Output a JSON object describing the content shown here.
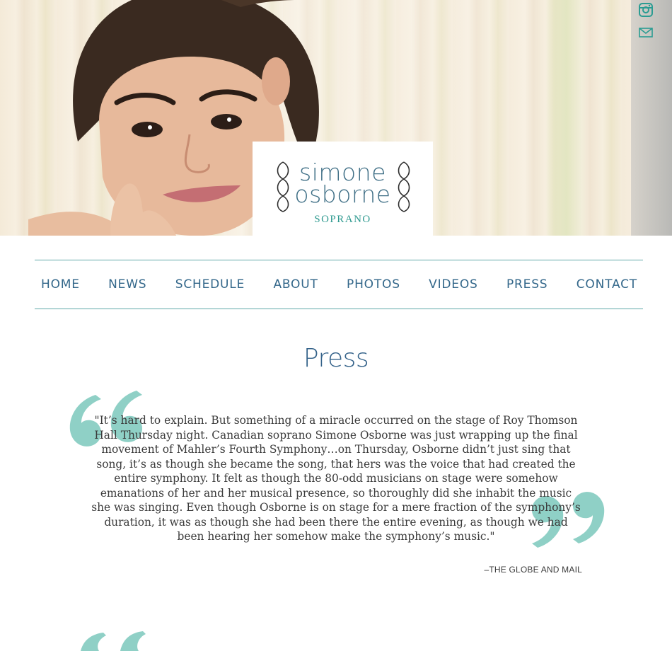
{
  "logo": {
    "name_line1": "simone",
    "name_line2": "osborne",
    "subtitle": "SOPRANO"
  },
  "social": {
    "items": [
      "instagram-icon",
      "email-icon"
    ]
  },
  "nav": {
    "items": [
      "HOME",
      "NEWS",
      "SCHEDULE",
      "ABOUT",
      "PHOTOS",
      "VIDEOS",
      "PRESS",
      "CONTACT"
    ]
  },
  "page": {
    "title": "Press",
    "quote": "\"It’s hard to explain. But something of a miracle occurred on the stage of Roy Thomson Hall Thursday night. Canadian soprano Simone Osborne was just wrapping up the final movement of Mahler’s Fourth Symphony…on Thursday, Osborne didn’t just sing that song, it’s as though she became the song, that hers was the voice that had created the entire symphony. It felt as though the 80-odd musicians on stage were somehow emanations of her and her musical presence, so thoroughly did she inhabit the music she was singing. Even though Osborne is on stage for a mere fraction of the symphony’s duration, it was as though she had been there the entire evening, as though we had been hearing her somehow make the symphony’s music.\"",
    "source": "–THE GLOBE AND MAIL"
  },
  "colors": {
    "teal": "#5fa8a9",
    "nav_text": "#33678a",
    "quote_mark": "#8fd0c6"
  }
}
